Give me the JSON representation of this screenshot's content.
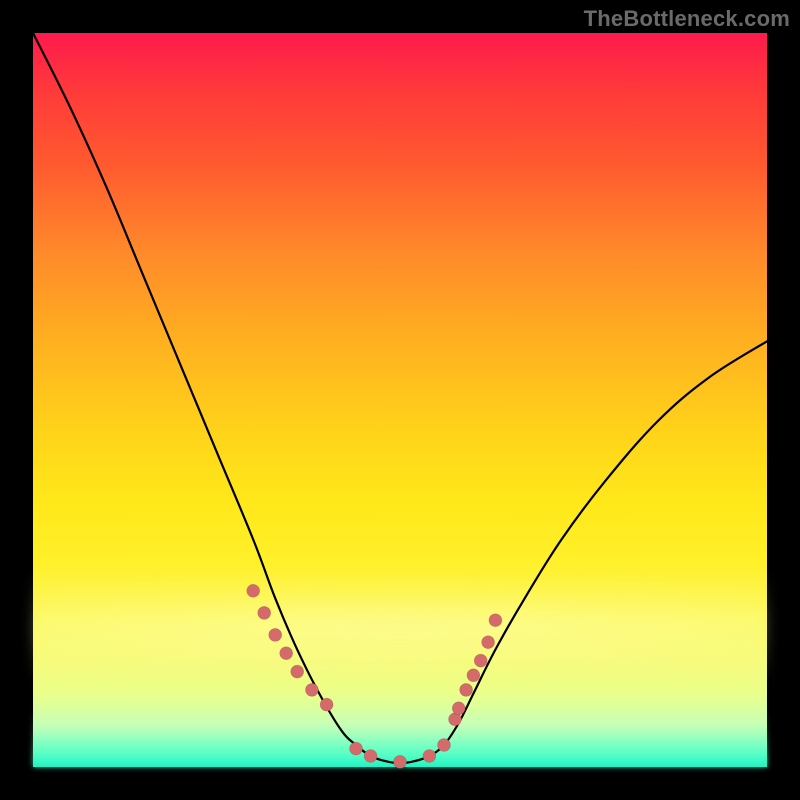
{
  "watermark": "TheBottleneck.com",
  "colors": {
    "frame": "#000000",
    "curve": "#000000",
    "dot": "#d46a6a",
    "gradient_top": "#ff1a4d",
    "gradient_bottom": "#18f0c0"
  },
  "chart_data": {
    "type": "line",
    "title": "",
    "xlabel": "",
    "ylabel": "",
    "xlim": [
      0,
      100
    ],
    "ylim": [
      0,
      100
    ],
    "grid": false,
    "legend": false,
    "notes": "Bottleneck-style curve on a red→yellow→green vertical gradient. No axis ticks or labels are rendered in the image; x and y are normalized 0–100 estimates read from pixel position. Lower y = closer to optimal (green). Pink dots mark highlighted sample points near the valley.",
    "series": [
      {
        "name": "curve",
        "x": [
          0,
          5,
          10,
          15,
          20,
          25,
          30,
          33,
          36,
          39,
          42,
          44,
          46,
          48,
          50,
          52,
          54,
          56,
          58,
          60,
          63,
          67,
          72,
          78,
          85,
          92,
          100
        ],
        "y": [
          100,
          90,
          79,
          67,
          55,
          43,
          31,
          23,
          16,
          10,
          5,
          3,
          1.5,
          0.8,
          0.5,
          0.8,
          1.5,
          3,
          6,
          10,
          16,
          23,
          31,
          39,
          47,
          53,
          58
        ]
      }
    ],
    "highlight_points": {
      "name": "dots",
      "x": [
        30,
        31.5,
        33,
        34.5,
        36,
        38,
        40,
        44,
        46,
        50,
        54,
        56,
        57.5,
        58,
        59,
        60,
        61,
        62,
        63
      ],
      "y": [
        24,
        21,
        18,
        15.5,
        13,
        10.5,
        8.5,
        2.5,
        1.5,
        0.7,
        1.5,
        3,
        6.5,
        8,
        10.5,
        12.5,
        14.5,
        17,
        20
      ]
    }
  }
}
